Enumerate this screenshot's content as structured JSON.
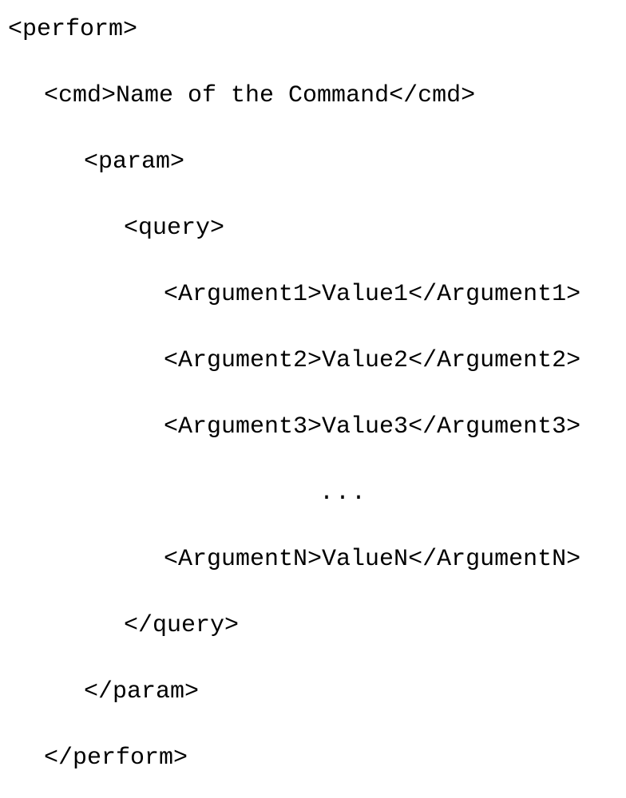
{
  "xml": {
    "perform_open": "<perform>",
    "cmd_open": "<cmd>",
    "cmd_text": "Name of the Command",
    "cmd_close": "</cmd>",
    "param_open": "<param>",
    "query_open": "<query>",
    "arguments": [
      {
        "open": "<Argument1>",
        "value": "Value1",
        "close": "</Argument1>"
      },
      {
        "open": "<Argument2>",
        "value": "Value2",
        "close": "</Argument2>"
      },
      {
        "open": "<Argument3>",
        "value": "Value3",
        "close": "</Argument3>"
      }
    ],
    "ellipsis": "...",
    "argumentN": {
      "open": "<ArgumentN>",
      "value": "ValueN",
      "close": "</ArgumentN>"
    },
    "query_close": "</query>",
    "param_close": "</param>",
    "perform_close": "</perform>"
  }
}
